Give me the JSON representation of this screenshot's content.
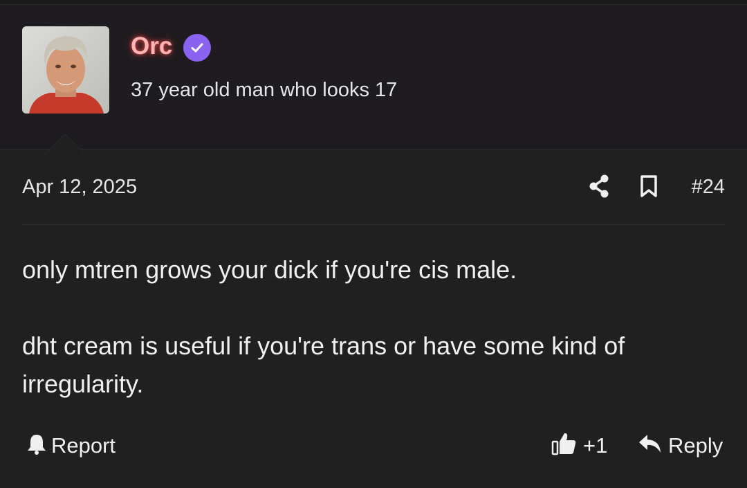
{
  "author": {
    "username": "Orc",
    "title": "37 year old man who looks 17",
    "verified_icon": "verified-check-icon",
    "username_color": "#ffb3b3",
    "verified_color": "#8a63f0"
  },
  "post": {
    "date": "Apr 12, 2025",
    "number": "#24",
    "message": [
      "only mtren grows your dick if you're cis male.",
      "dht cream is useful if you're trans or have some kind of irregularity."
    ]
  },
  "actions": {
    "share_icon": "share-icon",
    "bookmark_icon": "bookmark-icon",
    "report_label": "Report",
    "report_icon": "bell-icon",
    "like_count": "+1",
    "like_icon": "thumbs-up-icon",
    "reply_label": "Reply",
    "reply_icon": "reply-arrow-icon"
  }
}
